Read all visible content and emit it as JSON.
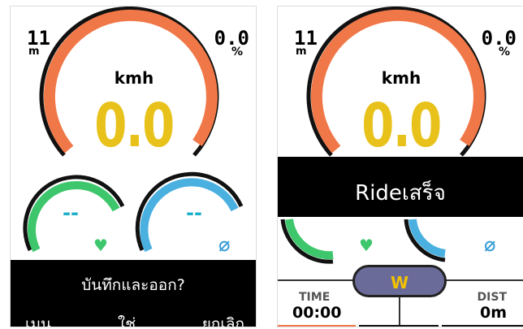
{
  "left_screen": {
    "altitude_value": "11",
    "altitude_unit": "m",
    "grade_value": "0.0",
    "grade_unit": "%",
    "speed_unit": "kmh",
    "speed_value": "0.0",
    "hr_value": "--",
    "power_value": "--",
    "dialog": {
      "message": "บันทึกและออก?",
      "softkeys": [
        "เมนู",
        "ใช่",
        "ยกเลิก"
      ]
    }
  },
  "right_screen": {
    "altitude_value": "11",
    "altitude_unit": "m",
    "grade_value": "0.0",
    "grade_unit": "%",
    "speed_unit": "kmh",
    "speed_value": "0.0",
    "banner": "Rideเสร็จ",
    "time_label": "TIME",
    "time_value": "00:00",
    "dist_label": "DIST",
    "dist_value": "0m",
    "power_unit": "W"
  },
  "icons": {
    "heart": "heart-icon",
    "sensor": "sensor-off-icon"
  },
  "colors": {
    "speed_arc": "#f07848",
    "speed_value": "#e8c21a",
    "hr_arc": "#3dc66b",
    "power_arc": "#4ab0e0",
    "dash": "#1bb0c9"
  }
}
